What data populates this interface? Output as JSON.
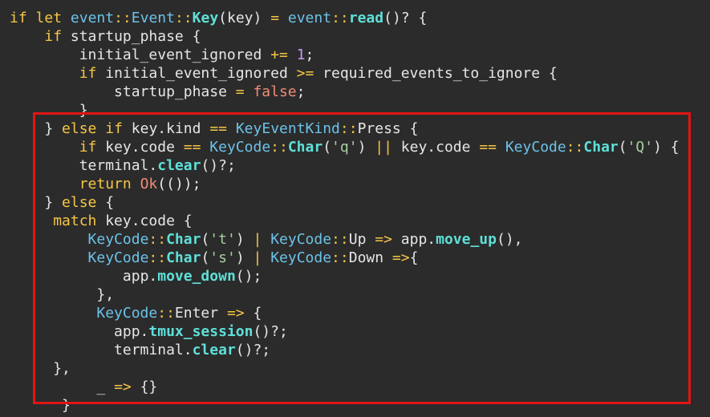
{
  "editor": {
    "lines": [
      {
        "indent": "",
        "tokens": [
          {
            "t": "if",
            "c": "kw"
          },
          {
            "t": " ",
            "c": "punc"
          },
          {
            "t": "let",
            "c": "kw"
          },
          {
            "t": " ",
            "c": "punc"
          },
          {
            "t": "event",
            "c": "ns"
          },
          {
            "t": "::",
            "c": "op"
          },
          {
            "t": "Event",
            "c": "ns"
          },
          {
            "t": "::",
            "c": "op"
          },
          {
            "t": "Key",
            "c": "fn"
          },
          {
            "t": "(key) ",
            "c": "punc"
          },
          {
            "t": "=",
            "c": "op"
          },
          {
            "t": " ",
            "c": "punc"
          },
          {
            "t": "event",
            "c": "ns"
          },
          {
            "t": "::",
            "c": "op"
          },
          {
            "t": "read",
            "c": "fn"
          },
          {
            "t": "()? {",
            "c": "punc"
          }
        ]
      },
      {
        "indent": "    ",
        "tokens": [
          {
            "t": "if",
            "c": "kw"
          },
          {
            "t": " startup_phase {",
            "c": "punc"
          }
        ]
      },
      {
        "indent": "        ",
        "tokens": [
          {
            "t": "initial_event_ignored ",
            "c": "id"
          },
          {
            "t": "+=",
            "c": "op"
          },
          {
            "t": " ",
            "c": "punc"
          },
          {
            "t": "1",
            "c": "num"
          },
          {
            "t": ";",
            "c": "punc"
          }
        ]
      },
      {
        "indent": "        ",
        "tokens": [
          {
            "t": "if",
            "c": "kw"
          },
          {
            "t": " initial_event_ignored ",
            "c": "id"
          },
          {
            "t": ">=",
            "c": "op"
          },
          {
            "t": " required_events_to_ignore {",
            "c": "id"
          }
        ]
      },
      {
        "indent": "            ",
        "tokens": [
          {
            "t": "startup_phase ",
            "c": "id"
          },
          {
            "t": "=",
            "c": "op"
          },
          {
            "t": " ",
            "c": "punc"
          },
          {
            "t": "false",
            "c": "bool"
          },
          {
            "t": ";",
            "c": "punc"
          }
        ]
      },
      {
        "indent": "        ",
        "tokens": [
          {
            "t": "}",
            "c": "punc"
          }
        ]
      },
      {
        "indent": "    ",
        "tokens": [
          {
            "t": "} ",
            "c": "punc"
          },
          {
            "t": "else",
            "c": "kw"
          },
          {
            "t": " ",
            "c": "punc"
          },
          {
            "t": "if",
            "c": "kw"
          },
          {
            "t": " key.kind ",
            "c": "id"
          },
          {
            "t": "==",
            "c": "op"
          },
          {
            "t": " ",
            "c": "punc"
          },
          {
            "t": "KeyEventKind",
            "c": "ns"
          },
          {
            "t": "::",
            "c": "op"
          },
          {
            "t": "Press {",
            "c": "id"
          }
        ]
      },
      {
        "indent": "        ",
        "tokens": [
          {
            "t": "if",
            "c": "kw"
          },
          {
            "t": " key.code ",
            "c": "id"
          },
          {
            "t": "==",
            "c": "op"
          },
          {
            "t": " ",
            "c": "punc"
          },
          {
            "t": "KeyCode",
            "c": "ns"
          },
          {
            "t": "::",
            "c": "op"
          },
          {
            "t": "Char",
            "c": "fn"
          },
          {
            "t": "(",
            "c": "punc"
          },
          {
            "t": "'q'",
            "c": "str"
          },
          {
            "t": ") ",
            "c": "punc"
          },
          {
            "t": "||",
            "c": "op"
          },
          {
            "t": " key.code ",
            "c": "id"
          },
          {
            "t": "==",
            "c": "op"
          },
          {
            "t": " ",
            "c": "punc"
          },
          {
            "t": "KeyCode",
            "c": "ns"
          },
          {
            "t": "::",
            "c": "op"
          },
          {
            "t": "Char",
            "c": "fn"
          },
          {
            "t": "(",
            "c": "punc"
          },
          {
            "t": "'Q'",
            "c": "str"
          },
          {
            "t": ") {",
            "c": "punc"
          }
        ]
      },
      {
        "indent": "        ",
        "tokens": [
          {
            "t": "terminal.",
            "c": "id"
          },
          {
            "t": "clear",
            "c": "fn"
          },
          {
            "t": "()?;",
            "c": "punc"
          }
        ]
      },
      {
        "indent": "        ",
        "tokens": [
          {
            "t": "return",
            "c": "kw"
          },
          {
            "t": " ",
            "c": "punc"
          },
          {
            "t": "Ok",
            "c": "bool"
          },
          {
            "t": "(());",
            "c": "punc"
          }
        ]
      },
      {
        "indent": "    ",
        "tokens": [
          {
            "t": "} ",
            "c": "punc"
          },
          {
            "t": "else",
            "c": "kw"
          },
          {
            "t": " {",
            "c": "punc"
          }
        ]
      },
      {
        "indent": "     ",
        "tokens": [
          {
            "t": "match",
            "c": "kw"
          },
          {
            "t": " key.code {",
            "c": "id"
          }
        ]
      },
      {
        "indent": "         ",
        "tokens": [
          {
            "t": "KeyCode",
            "c": "ns"
          },
          {
            "t": "::",
            "c": "op"
          },
          {
            "t": "Char",
            "c": "fn"
          },
          {
            "t": "(",
            "c": "punc"
          },
          {
            "t": "'t'",
            "c": "str"
          },
          {
            "t": ") ",
            "c": "punc"
          },
          {
            "t": "|",
            "c": "op"
          },
          {
            "t": " ",
            "c": "punc"
          },
          {
            "t": "KeyCode",
            "c": "ns"
          },
          {
            "t": "::",
            "c": "op"
          },
          {
            "t": "Up ",
            "c": "id"
          },
          {
            "t": "=>",
            "c": "op"
          },
          {
            "t": " app.",
            "c": "id"
          },
          {
            "t": "move_up",
            "c": "fn"
          },
          {
            "t": "(),",
            "c": "punc"
          }
        ]
      },
      {
        "indent": "         ",
        "tokens": [
          {
            "t": "KeyCode",
            "c": "ns"
          },
          {
            "t": "::",
            "c": "op"
          },
          {
            "t": "Char",
            "c": "fn"
          },
          {
            "t": "(",
            "c": "punc"
          },
          {
            "t": "'s'",
            "c": "str"
          },
          {
            "t": ") ",
            "c": "punc"
          },
          {
            "t": "|",
            "c": "op"
          },
          {
            "t": " ",
            "c": "punc"
          },
          {
            "t": "KeyCode",
            "c": "ns"
          },
          {
            "t": "::",
            "c": "op"
          },
          {
            "t": "Down ",
            "c": "id"
          },
          {
            "t": "=>",
            "c": "op"
          },
          {
            "t": "{",
            "c": "punc"
          }
        ]
      },
      {
        "indent": "             ",
        "tokens": [
          {
            "t": "app.",
            "c": "id"
          },
          {
            "t": "move_down",
            "c": "fn"
          },
          {
            "t": "();",
            "c": "punc"
          }
        ]
      },
      {
        "indent": "          ",
        "tokens": [
          {
            "t": "},",
            "c": "punc"
          }
        ]
      },
      {
        "indent": "          ",
        "tokens": [
          {
            "t": "KeyCode",
            "c": "ns"
          },
          {
            "t": "::",
            "c": "op"
          },
          {
            "t": "Enter ",
            "c": "id"
          },
          {
            "t": "=>",
            "c": "op"
          },
          {
            "t": " {",
            "c": "punc"
          }
        ]
      },
      {
        "indent": "            ",
        "tokens": [
          {
            "t": "app.",
            "c": "id"
          },
          {
            "t": "tmux_session",
            "c": "fn"
          },
          {
            "t": "()?;",
            "c": "punc"
          }
        ]
      },
      {
        "indent": "            ",
        "tokens": [
          {
            "t": "terminal.",
            "c": "id"
          },
          {
            "t": "clear",
            "c": "fn"
          },
          {
            "t": "()?;",
            "c": "punc"
          }
        ]
      },
      {
        "indent": "     ",
        "tokens": [
          {
            "t": "},",
            "c": "punc"
          }
        ]
      },
      {
        "indent": "          ",
        "tokens": [
          {
            "t": "_",
            "c": "id"
          },
          {
            "t": " ",
            "c": "punc"
          },
          {
            "t": "=>",
            "c": "op"
          },
          {
            "t": " {}",
            "c": "punc"
          }
        ]
      },
      {
        "indent": "      ",
        "tokens": [
          {
            "t": "}",
            "c": "punc"
          }
        ]
      }
    ]
  },
  "colors": {
    "background": "#2b2b2b",
    "keyword": "#f5c645",
    "type_namespace": "#6cc2e8",
    "function": "#5ee0d8",
    "number": "#c79bf2",
    "string": "#a8cfa0",
    "literal": "#f08d76",
    "text": "#e6e6e6",
    "highlight_border": "#e21414"
  }
}
